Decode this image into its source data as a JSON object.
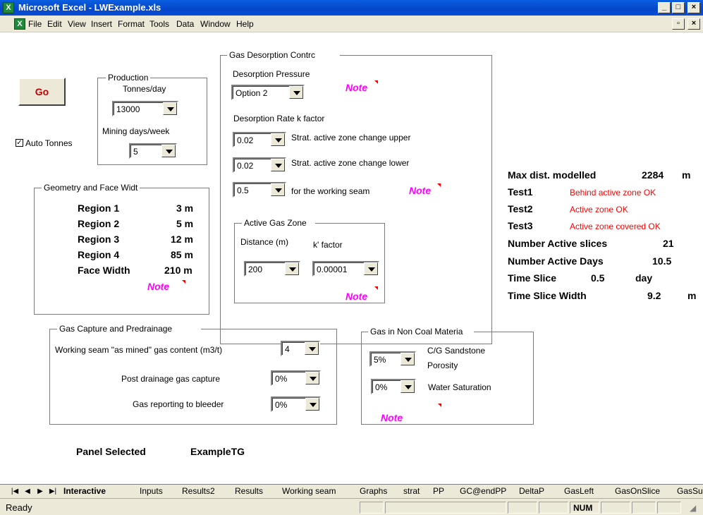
{
  "window": {
    "title": "Microsoft Excel - LWExample.xls",
    "app_icon": "excel-icon"
  },
  "menu": [
    "File",
    "Edit",
    "View",
    "Insert",
    "Format",
    "Tools",
    "Data",
    "Window",
    "Help"
  ],
  "go_button": "Go",
  "auto_tonnes": {
    "label": "Auto Tonnes",
    "checked": true
  },
  "production": {
    "title": "Production",
    "tonnes_label": "Tonnes/day",
    "tonnes_value": "13000",
    "days_label": "Mining days/week",
    "days_value": "5"
  },
  "geometry": {
    "title": "Geometry and Face Widt",
    "rows": [
      {
        "label": "Region 1",
        "value": "3 m"
      },
      {
        "label": "Region 2",
        "value": "5 m"
      },
      {
        "label": "Region 3",
        "value": "12 m"
      },
      {
        "label": "Region 4",
        "value": "85 m"
      },
      {
        "label": "Face Width",
        "value": "210 m"
      }
    ],
    "note": "Note"
  },
  "desorption": {
    "title": "Gas Desorption Contrc",
    "pressure_label": "Desorption Pressure",
    "pressure_value": "Option 2",
    "pressure_note": "Note",
    "rate_label": "Desorption Rate k factor",
    "rows": [
      {
        "value": "0.02",
        "label": "Strat. active zone change upper"
      },
      {
        "value": "0.02",
        "label": "Strat. active zone change lower"
      },
      {
        "value": "0.5",
        "label": "for the working seam"
      }
    ],
    "rate_note": "Note",
    "active_zone": {
      "title": "Active Gas Zone",
      "distance_label": "Distance (m)",
      "k_label": "k' factor",
      "distance_value": "200",
      "k_value": "0.00001",
      "note": "Note"
    }
  },
  "results": {
    "max_dist_label": "Max dist. modelled",
    "max_dist_value": "2284",
    "max_dist_unit": "m",
    "tests": [
      {
        "label": "Test1",
        "value": "Behind active zone OK"
      },
      {
        "label": "Test2",
        "value": "Active zone OK"
      },
      {
        "label": "Test3",
        "value": "Active zone covered OK"
      }
    ],
    "active_slices_label": "Number Active slices",
    "active_slices_value": "21",
    "active_days_label": "Number Active Days",
    "active_days_value": "10.5",
    "time_slice_label": "Time Slice",
    "time_slice_value": "0.5",
    "time_slice_unit": "day",
    "time_slice_width_label": "Time Slice Width",
    "time_slice_width_value": "9.2",
    "time_slice_width_unit": "m"
  },
  "capture": {
    "title": "Gas Capture and Predrainage",
    "seam_label": "Working seam \"as mined\" gas content (m3/t)",
    "seam_value": "4",
    "post_label": "Post drainage gas capture",
    "post_value": "0%",
    "bleeder_label": "Gas reporting to bleeder",
    "bleeder_value": "0%"
  },
  "noncoal": {
    "title": "Gas in Non Coal Materia",
    "porosity_value": "5%",
    "porosity_label_1": "C/G Sandstone",
    "porosity_label_2": "Porosity",
    "water_value": "0%",
    "water_label": "Water Saturation",
    "note": "Note"
  },
  "panel": {
    "label": "Panel Selected",
    "value": "ExampleTG"
  },
  "tabs": [
    "Interactive",
    "Inputs",
    "Results2",
    "Results",
    "Working seam",
    "Graphs",
    "strat",
    "PP",
    "GC@endPP",
    "DeltaP",
    "GasLeft",
    "GasOnSlice",
    "GasSu"
  ],
  "status": {
    "ready": "Ready",
    "num": "NUM"
  },
  "colors": {
    "title_bar": "#0546c8",
    "note": "#ff00ff",
    "ok_text": "#ff0000",
    "go_text": "#c00000"
  }
}
